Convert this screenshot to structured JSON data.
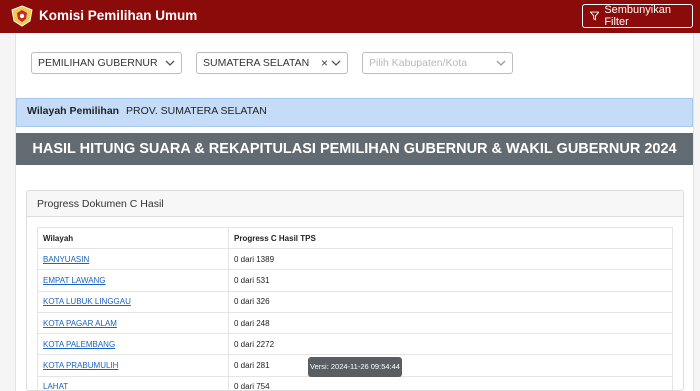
{
  "header": {
    "brand": "Komisi Pemilihan Umum",
    "logo_icon": "kpu-logo-icon",
    "filter_button_label": "Sembunyikan Filter",
    "filter_icon": "filter-icon"
  },
  "filters": {
    "pemilihan": "PEMILIHAN GUBERNUR",
    "provinsi": "SUMATERA SELATAN",
    "clear_symbol": "×",
    "kabupaten_placeholder": "Pilih Kabupaten/Kota"
  },
  "wilayah": {
    "label": "Wilayah Pemilihan",
    "value": "PROV. SUMATERA SELATAN"
  },
  "banner": {
    "title": "HASIL HITUNG SUARA & REKAPITULASI PEMILIHAN GUBERNUR & WAKIL GUBERNUR 2024"
  },
  "progress": {
    "title": "Progress Dokumen C Hasil",
    "columns": [
      "Wilayah",
      "Progress C Hasil TPS"
    ],
    "rows": [
      {
        "wilayah": "BANYUASIN",
        "progress": "0 dari 1389"
      },
      {
        "wilayah": "EMPAT LAWANG",
        "progress": "0 dari 531"
      },
      {
        "wilayah": "KOTA LUBUK LINGGAU",
        "progress": "0 dari 326"
      },
      {
        "wilayah": "KOTA PAGAR ALAM",
        "progress": "0 dari 248"
      },
      {
        "wilayah": "KOTA PALEMBANG",
        "progress": "0 dari 2272"
      },
      {
        "wilayah": "KOTA PRABUMULIH",
        "progress": "0 dari 281"
      },
      {
        "wilayah": "LAHAT",
        "progress": "0 dari 754"
      }
    ]
  },
  "version": "Versi: 2024-11-26 09:54:44",
  "colors": {
    "topbar": "#8b0a0a",
    "banner": "#636b72",
    "wilayah_bar": "#c4dcf7",
    "link": "#1a62c4"
  }
}
